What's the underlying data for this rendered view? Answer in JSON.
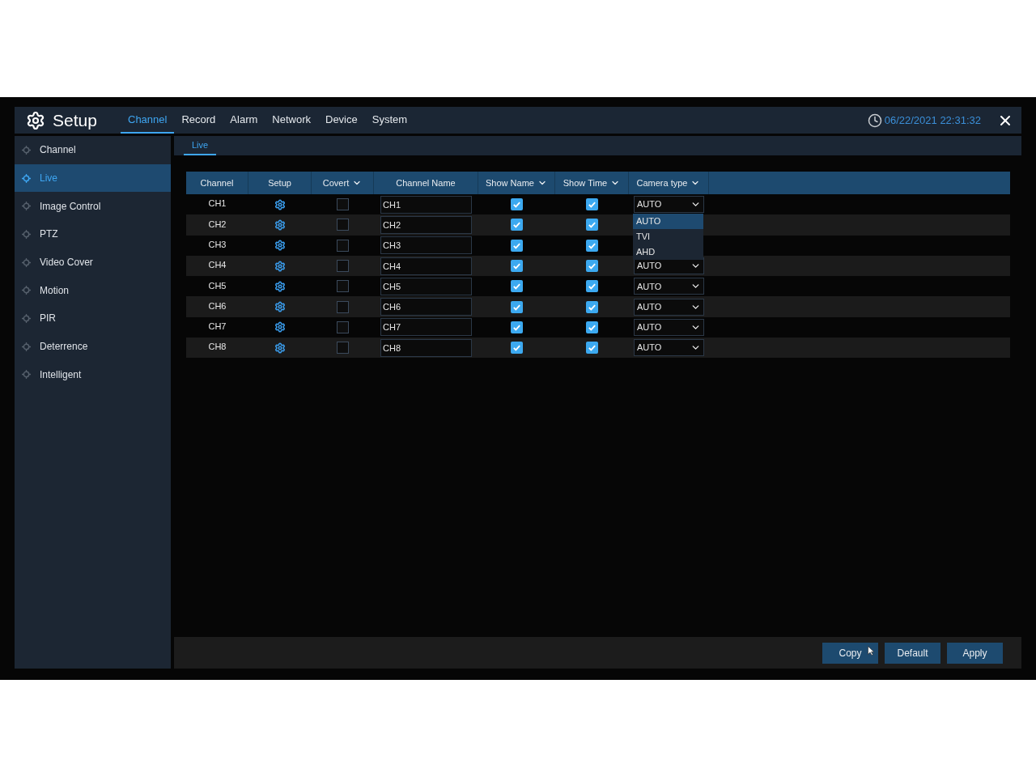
{
  "header": {
    "title": "Setup",
    "tabs": [
      {
        "label": "Channel",
        "selected": true
      },
      {
        "label": "Record",
        "selected": false
      },
      {
        "label": "Alarm",
        "selected": false
      },
      {
        "label": "Network",
        "selected": false
      },
      {
        "label": "Device",
        "selected": false
      },
      {
        "label": "System",
        "selected": false
      }
    ],
    "datetime": "06/22/2021 22:31:32"
  },
  "sidebar": {
    "items": [
      {
        "label": "Channel",
        "selected": false
      },
      {
        "label": "Live",
        "selected": true
      },
      {
        "label": "Image Control",
        "selected": false
      },
      {
        "label": "PTZ",
        "selected": false
      },
      {
        "label": "Video Cover",
        "selected": false
      },
      {
        "label": "Motion",
        "selected": false
      },
      {
        "label": "PIR",
        "selected": false
      },
      {
        "label": "Deterrence",
        "selected": false
      },
      {
        "label": "Intelligent",
        "selected": false
      }
    ]
  },
  "subtabs": [
    {
      "label": "Live",
      "selected": true
    }
  ],
  "table": {
    "columns": [
      {
        "label": "Channel",
        "has_menu": false
      },
      {
        "label": "Setup",
        "has_menu": false
      },
      {
        "label": "Covert",
        "has_menu": true
      },
      {
        "label": "Channel Name",
        "has_menu": false
      },
      {
        "label": "Show Name",
        "has_menu": true
      },
      {
        "label": "Show Time",
        "has_menu": true
      },
      {
        "label": "Camera type",
        "has_menu": true
      }
    ],
    "rows": [
      {
        "channel": "CH1",
        "covert": false,
        "name": "CH1",
        "show_name": true,
        "show_time": true,
        "camera_type": "AUTO",
        "options": [
          {
            "label": "AUTO",
            "selected": true
          },
          {
            "label": "TVI",
            "selected": false
          },
          {
            "label": "AHD",
            "selected": false
          }
        ]
      },
      {
        "channel": "CH2",
        "covert": false,
        "name": "CH2",
        "show_name": true,
        "show_time": true
      },
      {
        "channel": "CH3",
        "covert": false,
        "name": "CH3",
        "show_name": true,
        "show_time": true
      },
      {
        "channel": "CH4",
        "covert": false,
        "name": "CH4",
        "show_name": true,
        "show_time": true,
        "camera_type": "AUTO"
      },
      {
        "channel": "CH5",
        "covert": false,
        "name": "CH5",
        "show_name": true,
        "show_time": true,
        "camera_type": "AUTO"
      },
      {
        "channel": "CH6",
        "covert": false,
        "name": "CH6",
        "show_name": true,
        "show_time": true,
        "camera_type": "AUTO"
      },
      {
        "channel": "CH7",
        "covert": false,
        "name": "CH7",
        "show_name": true,
        "show_time": true,
        "camera_type": "AUTO"
      },
      {
        "channel": "CH8",
        "covert": false,
        "name": "CH8",
        "show_name": true,
        "show_time": true,
        "camera_type": "AUTO"
      }
    ]
  },
  "buttons": [
    "Copy",
    "Default",
    "Apply"
  ]
}
